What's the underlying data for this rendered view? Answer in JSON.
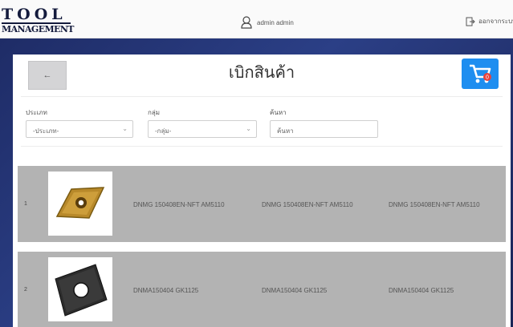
{
  "header": {
    "logo_line1": "TOOL",
    "logo_line2": "MANAGEMENT",
    "user_name": "admin admin",
    "logout_label": "ออกจากระบบ"
  },
  "page": {
    "title": "เบิกสินค้า",
    "back_icon": "arrow-left-icon",
    "cart_icon": "cart-icon",
    "cart_badge": "0"
  },
  "filters": {
    "type_label": "ประเภท",
    "type_value": "-ประเภท-",
    "group_label": "กลุ่ม",
    "group_value": "-กลุ่ม-",
    "search_label": "ค้นหา",
    "search_placeholder": "ค้นหา"
  },
  "products": [
    {
      "index": "1",
      "col1": "DNMG 150408EN-NFT AM5110",
      "col2": "DNMG 150408EN-NFT AM5110",
      "col3": "DNMG 150408EN-NFT AM5110",
      "image": "gold-rhombic-insert"
    },
    {
      "index": "2",
      "col1": "DNMA150404 GK1125",
      "col2": "DNMA150404 GK1125",
      "col3": "DNMA150404 GK1125",
      "image": "black-rhombic-insert"
    }
  ],
  "colors": {
    "accent": "#1e8ef0",
    "row_bg": "#b3b3b3",
    "backdrop": "#24357a"
  }
}
